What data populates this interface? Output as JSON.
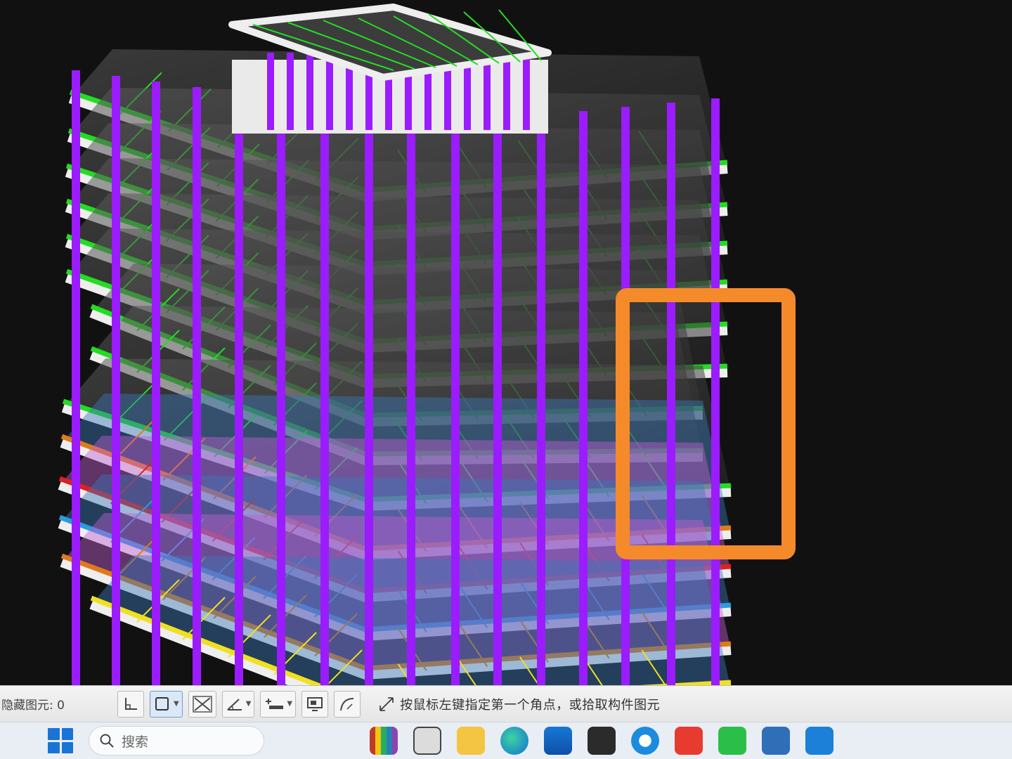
{
  "statusbar": {
    "hidden_elements_label": "隐藏图元: 0",
    "prompt": "按鼠标左键指定第一个角点，或拾取构件图元",
    "tools": [
      {
        "icon": "orthogonal-icon"
      },
      {
        "icon": "box-select-icon",
        "dropdown": true,
        "active": true
      },
      {
        "icon": "cross-select-icon"
      },
      {
        "icon": "angle-icon",
        "dropdown": true
      },
      {
        "icon": "offset-icon",
        "dropdown": true
      },
      {
        "icon": "display-icon"
      },
      {
        "icon": "arc-icon"
      }
    ]
  },
  "taskbar": {
    "search_placeholder": "搜索",
    "apps": [
      "books-app-icon",
      "file-app-icon",
      "folder-app-icon",
      "edge-browser-icon",
      "store-app-icon",
      "glodon-app-icon",
      "edge-alt-icon",
      "wps-app-icon",
      "wechat-app-icon",
      "monitor-app-icon",
      "layers-app-icon"
    ]
  },
  "colors": {
    "beam": "#22dd22",
    "column": "#9b1cff",
    "slab_edge": "#eeeeee",
    "highlight_box": "#f58a2a",
    "statusbar_bg": "#eeeeee",
    "taskbar_bg": "#e9eef4"
  }
}
